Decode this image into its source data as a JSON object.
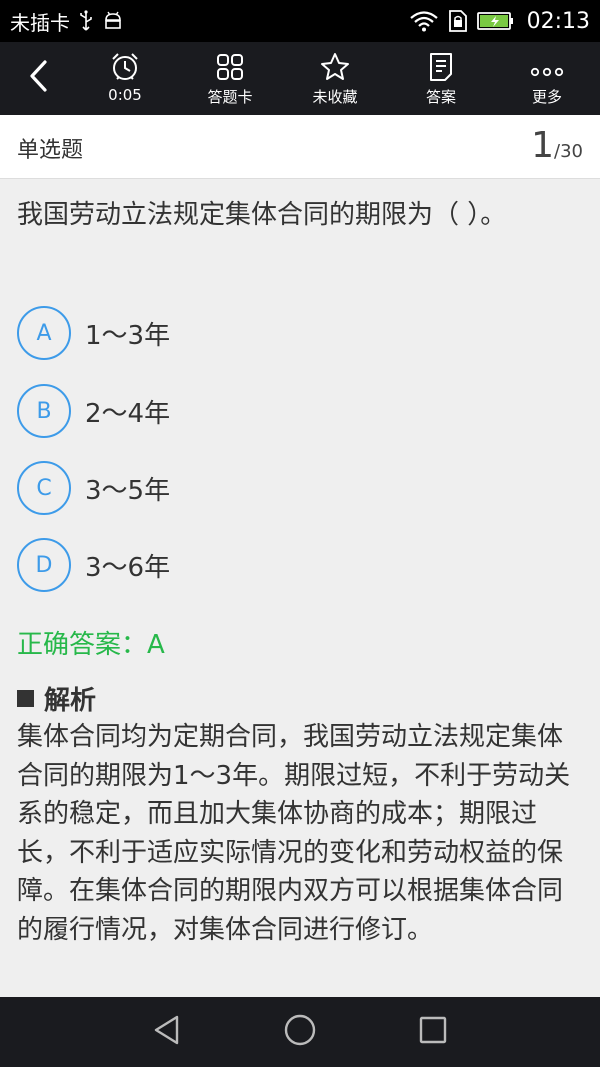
{
  "statusbar": {
    "carrier": "未插卡",
    "time": "02:13"
  },
  "toolbar": {
    "back_icon": "back-arrow-icon",
    "items": [
      {
        "label": "0:05",
        "icon": "alarm-clock-icon"
      },
      {
        "label": "答题卡",
        "icon": "grid-icon"
      },
      {
        "label": "未收藏",
        "icon": "star-outline-icon"
      },
      {
        "label": "答案",
        "icon": "document-icon"
      },
      {
        "label": "更多",
        "icon": "more-dots-icon"
      }
    ]
  },
  "question_header": {
    "type": "单选题",
    "current": "1",
    "total": "/30"
  },
  "question": {
    "text": "我国劳动立法规定集体合同的期限为（ ）。",
    "options": [
      {
        "letter": "A",
        "text": "1～3年"
      },
      {
        "letter": "B",
        "text": "2～4年"
      },
      {
        "letter": "C",
        "text": "3～5年"
      },
      {
        "letter": "D",
        "text": "3～6年"
      }
    ]
  },
  "answer": {
    "label": "正确答案：A"
  },
  "analysis": {
    "title": "解析",
    "text": "集体合同均为定期合同，我国劳动立法规定集体合同的期限为1～3年。期限过短，不利于劳动关系的稳定，而且加大集体协商的成本；期限过长，不利于适应实际情况的变化和劳动权益的保障。在集体合同的期限内双方可以根据集体合同的履行情况，对集体合同进行修订。"
  },
  "colors": {
    "accent": "#3d9be9",
    "correct": "#27b84a",
    "toolbar_bg": "#1a1b1f"
  }
}
